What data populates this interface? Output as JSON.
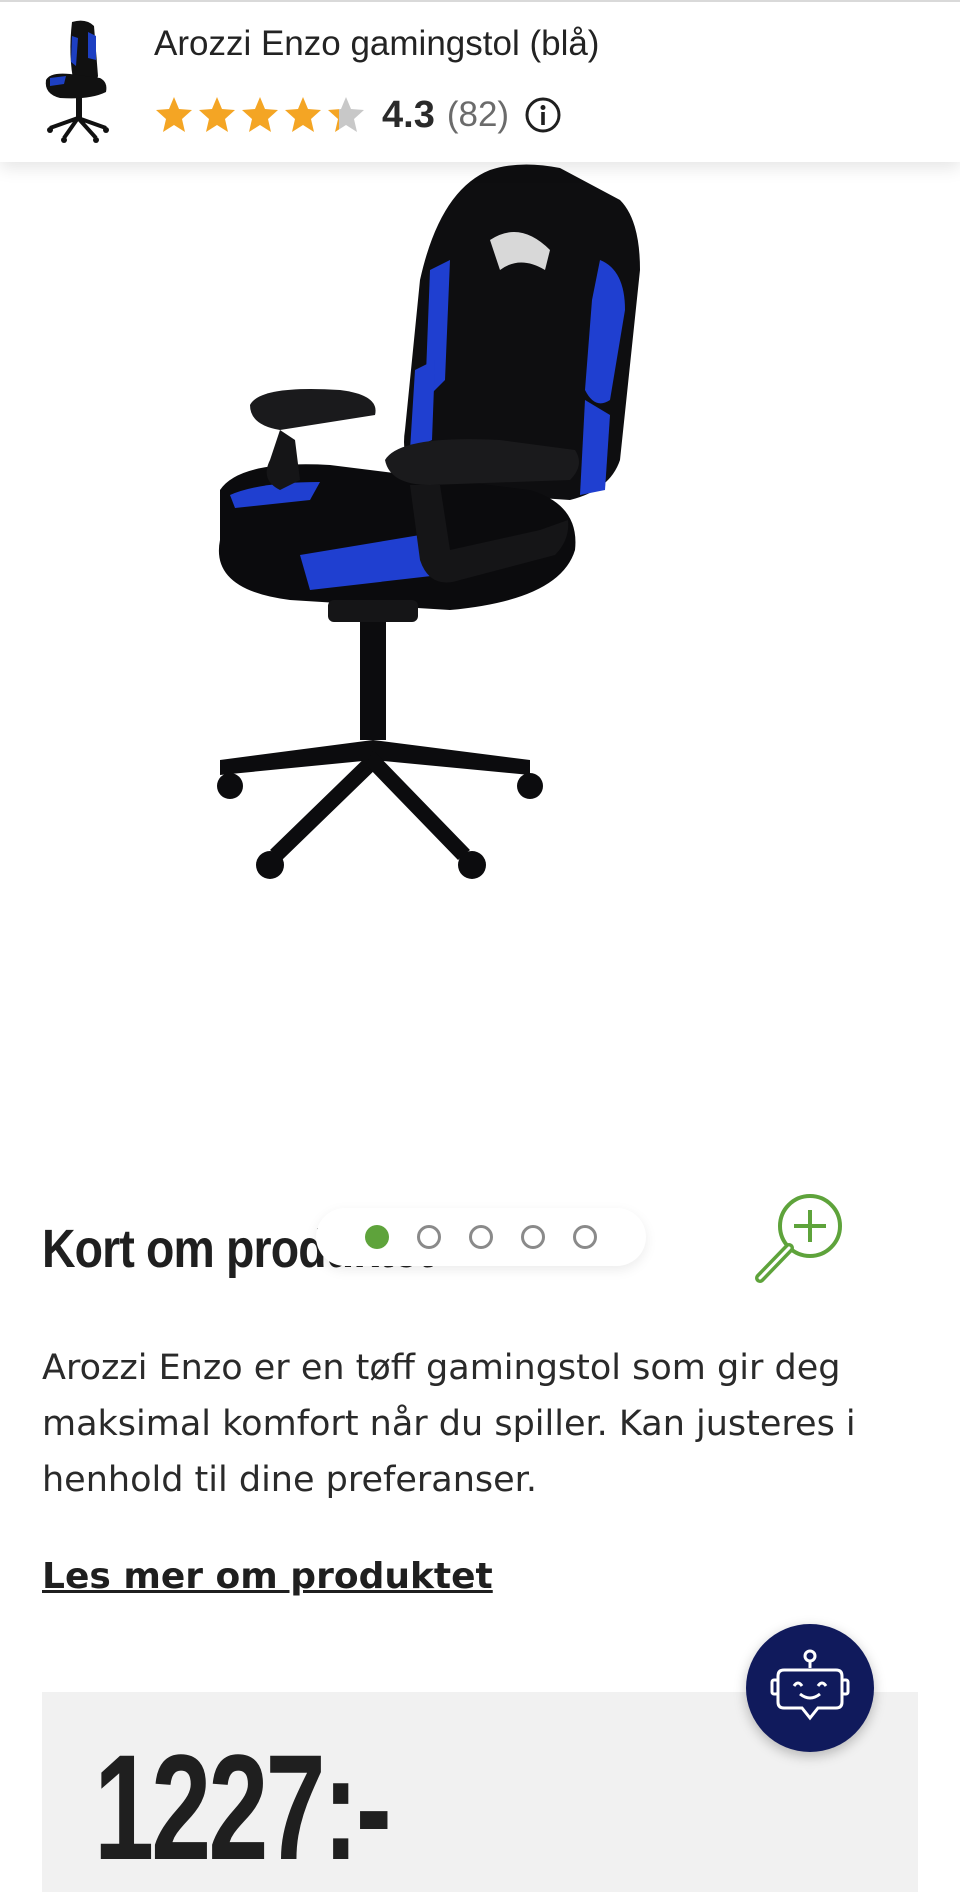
{
  "header": {
    "title": "Arozzi Enzo gamingstol (blå)",
    "rating_value": "4.3",
    "rating_count": "(82)",
    "rating": 4.3,
    "max_rating": 5,
    "thumbnail_icon": "chair-thumbnail",
    "info_icon": "info-icon"
  },
  "gallery": {
    "image_count": 5,
    "active_index": 0,
    "zoom_icon": "zoom-in-icon",
    "accent_color": "#5ea33b"
  },
  "description": {
    "heading": "Kort om produktet",
    "text": "Arozzi Enzo er en tøff gamingstol som gir deg maksimal komfort når du spiller. Kan justeres i henhold til dine preferanser.",
    "read_more": "Les mer om produktet"
  },
  "price": {
    "value": "1227:-"
  },
  "chatbot": {
    "icon": "robot-chat-icon",
    "color": "#101a5c"
  },
  "colors": {
    "star": "#f4a524",
    "star_empty": "#c8c8c8",
    "price_bg": "#f1f1f1"
  }
}
